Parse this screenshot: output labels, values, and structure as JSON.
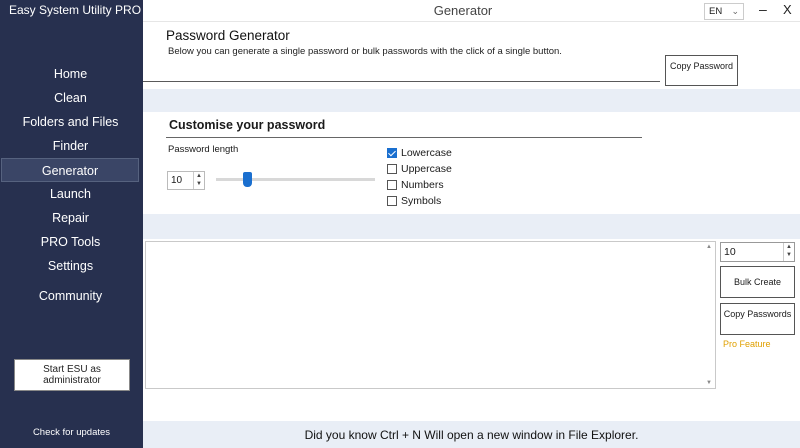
{
  "app": {
    "title": "Easy System Utility PRO"
  },
  "window": {
    "title": "Generator",
    "language": "EN",
    "minimize": "–",
    "close": "X"
  },
  "sidebar": {
    "items": [
      {
        "label": "Home"
      },
      {
        "label": "Clean"
      },
      {
        "label": "Folders and Files"
      },
      {
        "label": "Finder"
      },
      {
        "label": "Generator",
        "active": true
      },
      {
        "label": "Launch"
      },
      {
        "label": "Repair"
      },
      {
        "label": "PRO Tools"
      },
      {
        "label": "Settings"
      },
      {
        "label": "Community"
      }
    ],
    "admin_button": "Start ESU as administrator",
    "check_updates": "Check for updates"
  },
  "generator": {
    "heading": "Password Generator",
    "description": "Below you can generate a single password or bulk passwords with the click of a single button.",
    "single_output": "",
    "copy_button": "Copy Password"
  },
  "customise": {
    "title": "Customise your password",
    "length_label": "Password length",
    "length_value": "10",
    "options": [
      {
        "label": "Lowercase",
        "checked": true
      },
      {
        "label": "Uppercase",
        "checked": false
      },
      {
        "label": "Numbers",
        "checked": false
      },
      {
        "label": "Symbols",
        "checked": false
      }
    ]
  },
  "bulk": {
    "count": "10",
    "bulk_create": "Bulk Create",
    "copy_passwords": "Copy Passwords",
    "pro_feature": "Pro Feature"
  },
  "footer": {
    "tip": "Did you know Ctrl + N Will open a new window in File Explorer."
  },
  "colors": {
    "sidebar": "#27304f",
    "accent": "#1a6fcf",
    "pro": "#e0a000",
    "band": "#e9eef6"
  }
}
